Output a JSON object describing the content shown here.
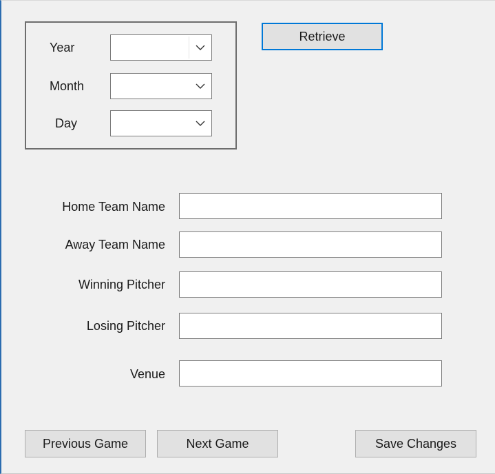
{
  "date_group": {
    "year_label": "Year",
    "month_label": "Month",
    "day_label": "Day",
    "year_value": "",
    "month_value": "",
    "day_value": ""
  },
  "retrieve_label": "Retrieve",
  "fields": {
    "home_team_label": "Home Team Name",
    "home_team_value": "",
    "away_team_label": "Away Team Name",
    "away_team_value": "",
    "winning_pitcher_label": "Winning Pitcher",
    "winning_pitcher_value": "",
    "losing_pitcher_label": "Losing Pitcher",
    "losing_pitcher_value": "",
    "venue_label": "Venue",
    "venue_value": ""
  },
  "buttons": {
    "previous_label": "Previous Game",
    "next_label": "Next Game",
    "save_label": "Save Changes"
  },
  "icons": {
    "dropdown": "chevron-down-icon"
  },
  "colors": {
    "background": "#f0f0f0",
    "focus_border": "#0078d7",
    "button_face": "#e1e1e1"
  }
}
